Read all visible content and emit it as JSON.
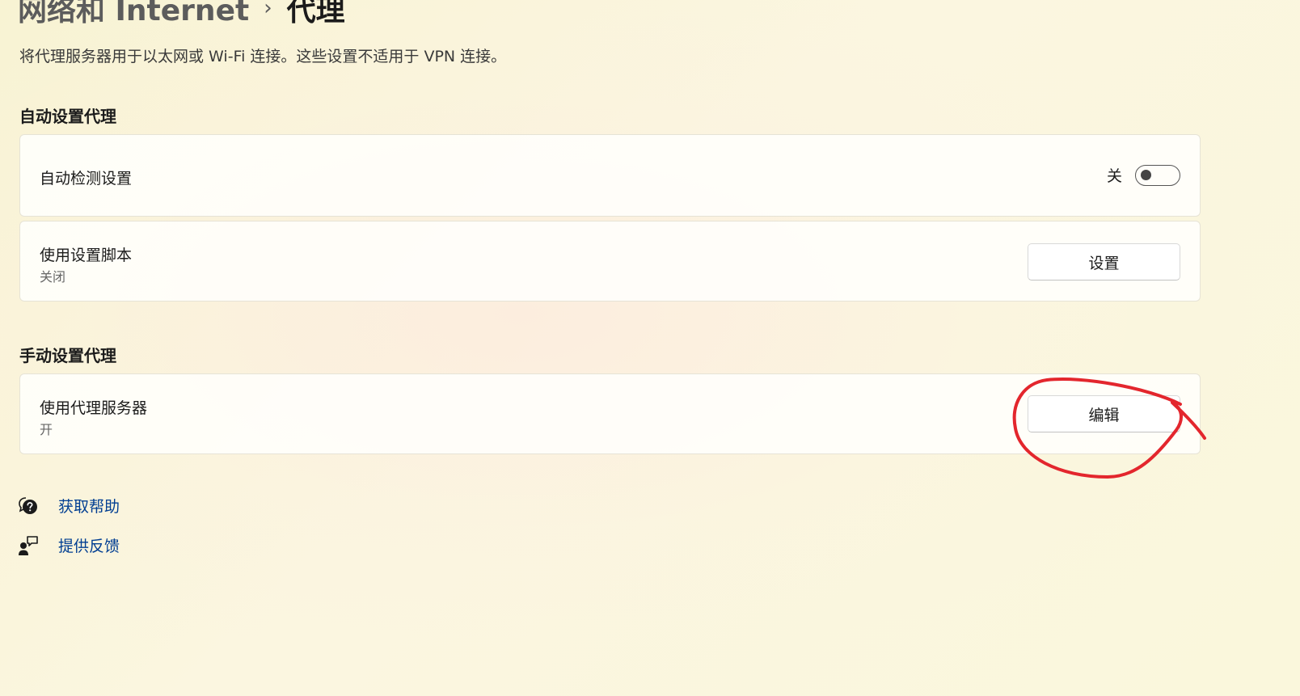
{
  "breadcrumb": {
    "parent": "网络和 Internet",
    "separator": "›",
    "current": "代理"
  },
  "description": "将代理服务器用于以太网或 Wi-Fi 连接。这些设置不适用于 VPN 连接。",
  "auto_section": {
    "title": "自动设置代理",
    "detect": {
      "label": "自动检测设置",
      "state_label": "关",
      "on": false
    },
    "script": {
      "label": "使用设置脚本",
      "status": "关闭",
      "button": "设置"
    }
  },
  "manual_section": {
    "title": "手动设置代理",
    "proxy": {
      "label": "使用代理服务器",
      "status": "开",
      "button": "编辑"
    }
  },
  "links": {
    "help": {
      "label": "获取帮助",
      "icon": "help-chat-icon"
    },
    "feedback": {
      "label": "提供反馈",
      "icon": "feedback-icon"
    }
  },
  "annotation_color": "#e3262d"
}
